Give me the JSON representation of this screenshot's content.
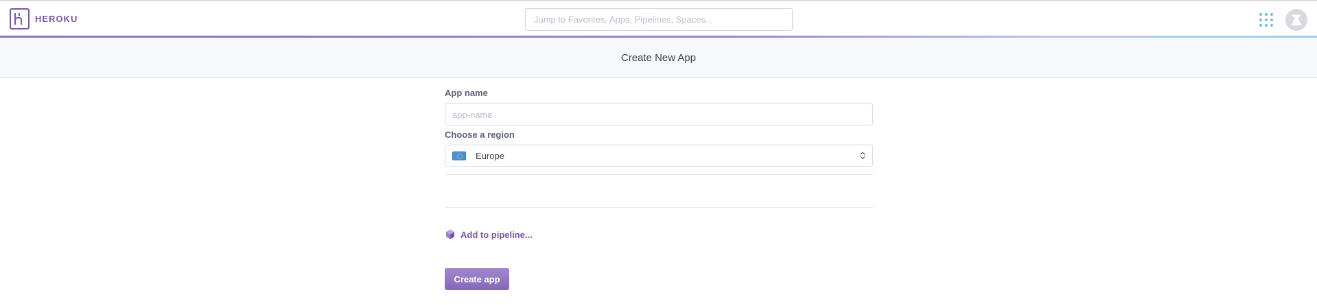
{
  "header": {
    "brand": "HEROKU",
    "search_placeholder": "Jump to Favorites, Apps, Pipelines, Spaces...",
    "icons": {
      "logo": "heroku-logo-icon",
      "apps_menu": "apps-grid-icon",
      "avatar": "user-avatar-icon"
    }
  },
  "page": {
    "title": "Create New App"
  },
  "form": {
    "app_name_label": "App name",
    "app_name_placeholder": "app-name",
    "app_name_value": "",
    "region_label": "Choose a region",
    "region_value": "Europe",
    "region_flag_icon": "eu-flag-icon",
    "pipeline_link": "Add to pipeline...",
    "pipeline_icon": "pipeline-hexagon-icon",
    "submit_label": "Create app"
  },
  "colors": {
    "brand_purple": "#79589f",
    "button_purple": "#8567ba",
    "grid_dots": "#70b9e0"
  }
}
